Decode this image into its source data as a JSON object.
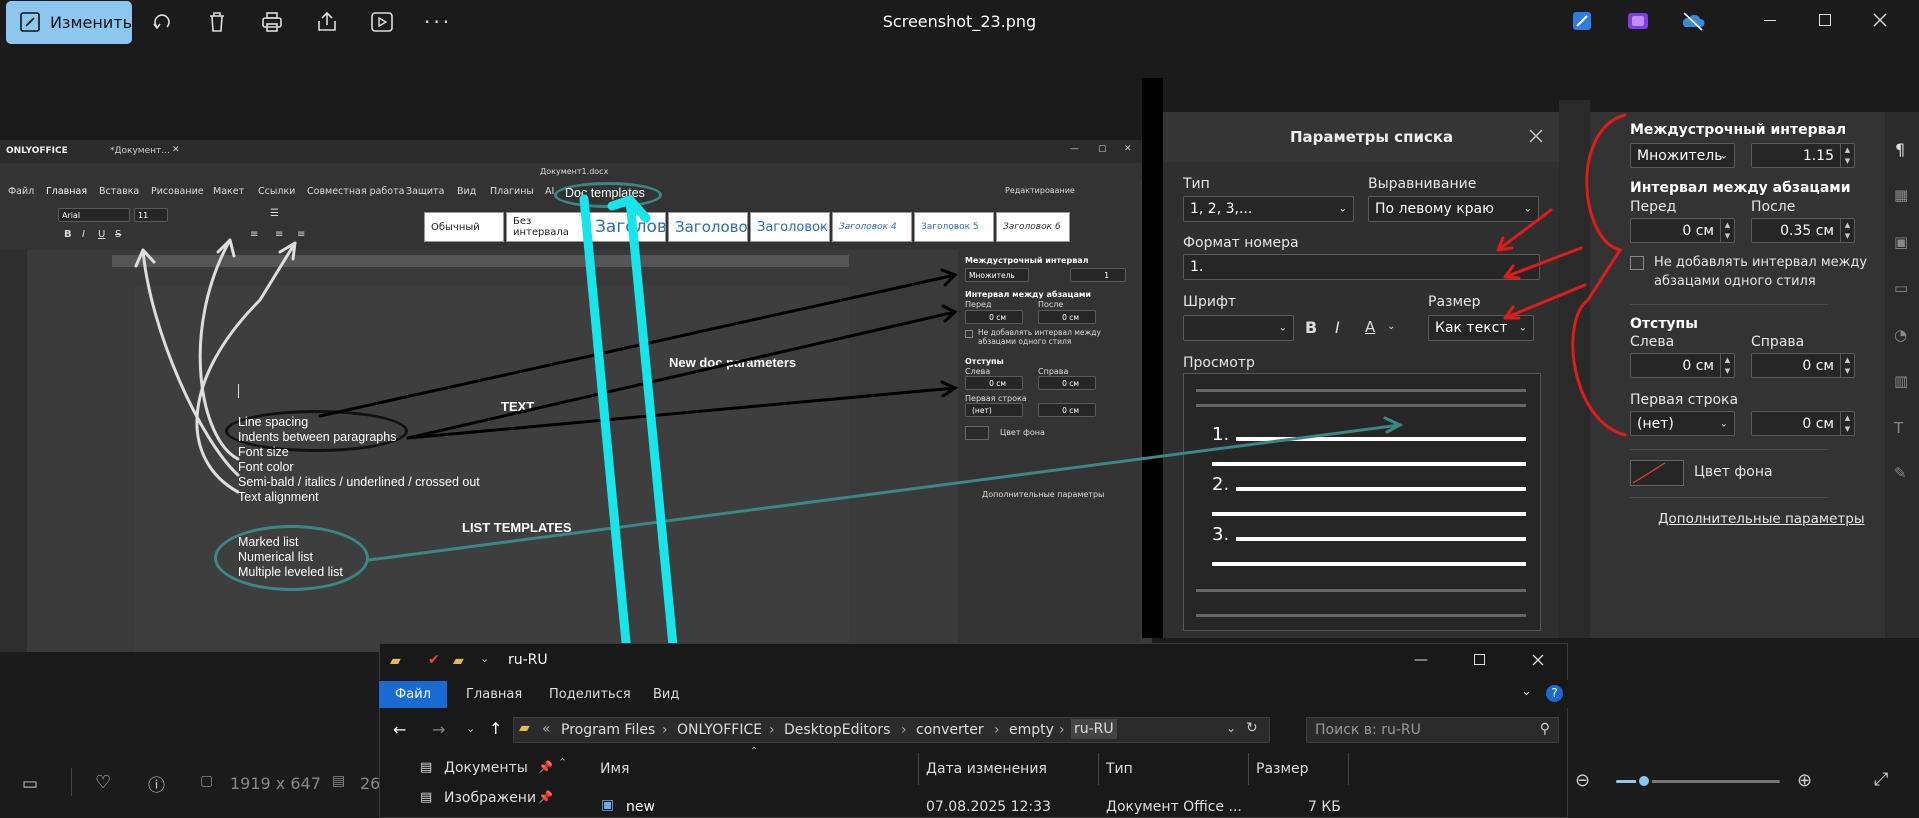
{
  "viewer": {
    "edit_label": "Изменить",
    "file_title": "Screenshot_23.png",
    "status_dims": "1919 x 647",
    "status_size": "26",
    "icons": [
      "rotate-icon",
      "trash-icon",
      "print-icon",
      "share-icon",
      "slideshow-icon",
      "more-icon",
      "paint-icon",
      "clipchamp-icon",
      "onedrive-off-icon",
      "minimize-icon",
      "maximize-icon",
      "close-icon"
    ]
  },
  "onlyoffice": {
    "brand": "ONLYOFFICE",
    "tab_title": "*Документ...",
    "doc_title": "Документ1.docx",
    "menu": [
      "Файл",
      "Главная",
      "Вставка",
      "Рисование",
      "Макет",
      "Ссылки",
      "Совместная работа",
      "Защита",
      "Вид",
      "Плагины",
      "AI"
    ],
    "edit_mode": "Редактирование",
    "font_name": "Arial",
    "font_size": "11",
    "styles": [
      "Обычный",
      "Без интервала",
      "Заголов",
      "Заголово",
      "Заголовок",
      "Заголовок 4",
      "Заголовок 5",
      "Заголовок 6"
    ],
    "side": {
      "line_spacing_title": "Междустрочный интервал",
      "line_spacing_mode": "Множитель",
      "line_spacing_value": "1",
      "para_spacing_title": "Интервал между абзацами",
      "before": "Перед",
      "after": "После",
      "before_val": "0 см",
      "after_val": "0 см",
      "no_space": "Не добавлять интервал между абзацами одного стиля",
      "indents_title": "Отступы",
      "left": "Слева",
      "right": "Справа",
      "left_val": "0 см",
      "right_val": "0 см",
      "first_line": "Первая строка",
      "first_line_val": "(нет)",
      "first_line_num": "0 см",
      "bg_color": "Цвет фона",
      "advanced": "Дополнительные параметры"
    }
  },
  "annotations": {
    "doc_templates": "Doc templates",
    "new_doc_params": "New doc parameters",
    "text_label": "TEXT",
    "list_templates": "LIST TEMPLATES",
    "text_items": [
      "Line spacing",
      "Indents between paragraphs",
      "Font size",
      "Font color",
      "Semi-bald / italics / underlined / crossed out",
      "Text alignment"
    ],
    "list_items": [
      "Marked list",
      "Numerical list",
      "Multiple leveled list"
    ]
  },
  "list_dialog": {
    "title": "Параметры списка",
    "type_label": "Тип",
    "type_value": "1, 2, 3,...",
    "align_label": "Выравнивание",
    "align_value": "По левому краю",
    "format_label": "Формат номера",
    "format_value": "1.",
    "font_label": "Шрифт",
    "size_label": "Размер",
    "size_value": "Как текст",
    "preview_label": "Просмотр",
    "preview_numbers": [
      "1.",
      "2.",
      "3."
    ]
  },
  "para_panel": {
    "line_spacing_title": "Междустрочный интервал",
    "line_spacing_mode": "Множитель",
    "line_spacing_value": "1.15",
    "para_spacing_title": "Интервал между абзацами",
    "before": "Перед",
    "after": "После",
    "before_val": "0 см",
    "after_val": "0.35 см",
    "no_space": "Не добавлять интервал между абзацами одного стиля",
    "indents_title": "Отступы",
    "left": "Слева",
    "right": "Справа",
    "left_val": "0 см",
    "right_val": "0 см",
    "first_line": "Первая строка",
    "first_line_val": "(нет)",
    "first_line_num": "0 см",
    "bg_color": "Цвет фона",
    "advanced": "Дополнительные параметры"
  },
  "explorer": {
    "title": "ru-RU",
    "ribbon": [
      "Файл",
      "Главная",
      "Поделиться",
      "Вид"
    ],
    "path": [
      "Program Files",
      "ONLYOFFICE",
      "DesktopEditors",
      "converter",
      "empty",
      "ru-RU"
    ],
    "search_placeholder": "Поиск в: ru-RU",
    "nav": [
      "Документы",
      "Изображени"
    ],
    "columns": [
      "Имя",
      "Дата изменения",
      "Тип",
      "Размер"
    ],
    "rows": [
      {
        "name": "new",
        "date": "07.08.2025 12:33",
        "type": "Документ Office ...",
        "size": "7 КБ"
      }
    ]
  }
}
